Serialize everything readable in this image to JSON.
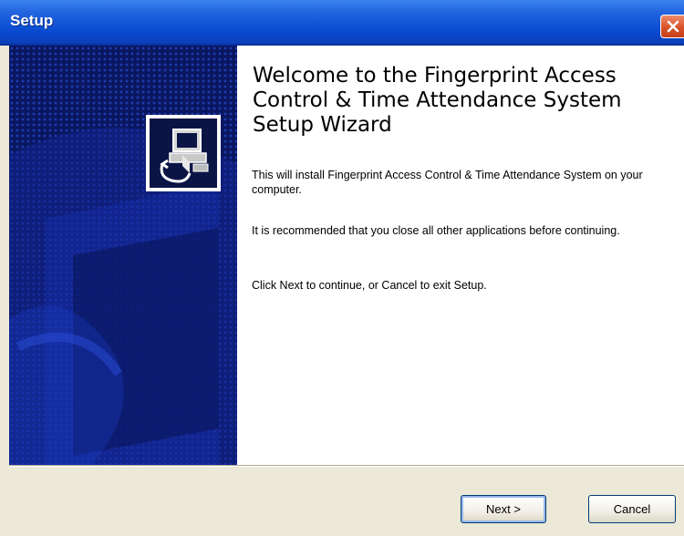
{
  "window": {
    "title": "Setup"
  },
  "welcome": {
    "heading": "Welcome to the Fingerprint Access Control & Time Attendance System Setup Wizard",
    "paragraph_install": "This will install Fingerprint Access Control & Time Attendance System on your computer.",
    "paragraph_recommend": "It is recommended that you close all other applications before continuing.",
    "paragraph_instructions": "Click Next to continue, or Cancel to exit Setup."
  },
  "buttons": {
    "next_label": "Next >",
    "cancel_label": "Cancel"
  },
  "icons": {
    "close": "close-icon",
    "installer": "installer-computer-icon"
  },
  "colors": {
    "titlebar": "#0a4bd2",
    "close_button": "#d9532a",
    "left_panel": "#0a1760",
    "dialog_background": "#ece9d8"
  }
}
